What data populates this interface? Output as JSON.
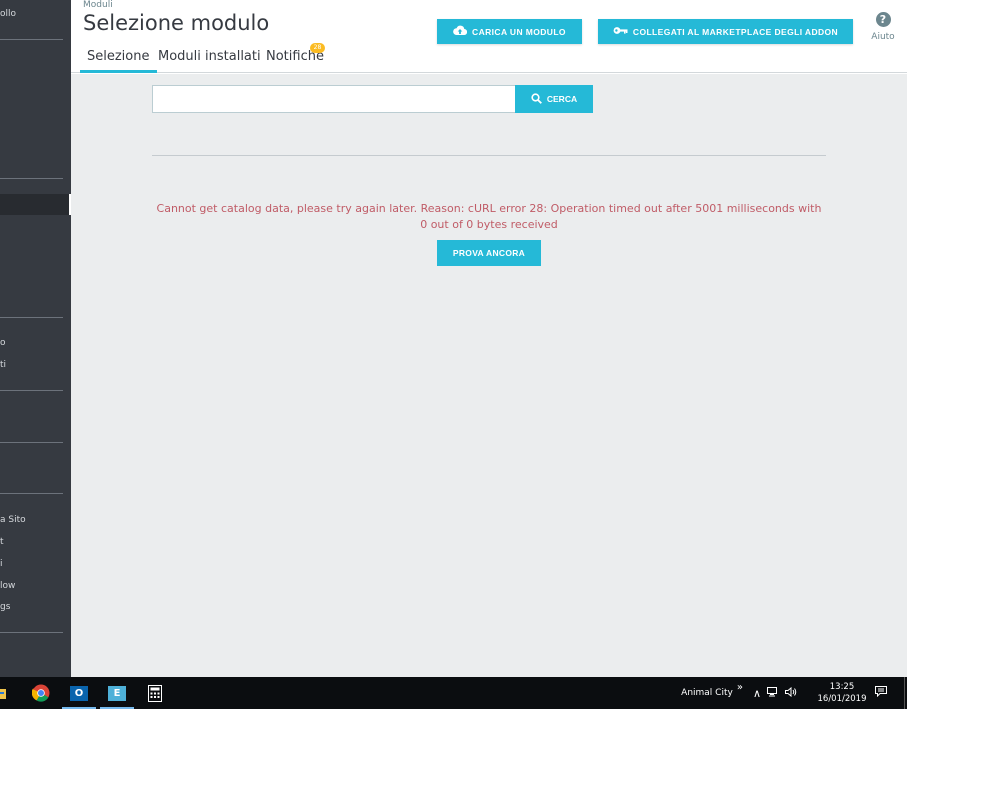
{
  "sidebar": {
    "items": [
      {
        "label": "ollo"
      },
      {
        "label": "o"
      },
      {
        "label": "ti"
      },
      {
        "label": "a Sito"
      },
      {
        "label": "t"
      },
      {
        "label": "i"
      },
      {
        "label": "low"
      },
      {
        "label": "gs"
      }
    ]
  },
  "header": {
    "breadcrumb": "Moduli",
    "title": "Selezione modulo",
    "tabs": [
      {
        "label": "Selezione",
        "active": true
      },
      {
        "label": "Moduli installati",
        "active": false
      },
      {
        "label": "Notifiche",
        "active": false
      }
    ],
    "notifications_count": "28",
    "upload_button": "CARICA UN MODULO",
    "marketplace_button": "COLLEGATI AL MARKETPLACE DEGLI ADDON",
    "help_label": "Aiuto"
  },
  "main": {
    "search_placeholder": "",
    "search_value": "",
    "search_button": "CERCA",
    "error_message": "Cannot get catalog data, please try again later. Reason: cURL error 28: Operation timed out after 5001 milliseconds with 0 out of 0 bytes received",
    "retry_button": "PROVA ANCORA"
  },
  "taskbar": {
    "apps": [
      "file-explorer-icon",
      "chrome-icon",
      "outlook-icon",
      "excel-icon",
      "calculator-icon"
    ],
    "outlook_glyph": "O",
    "excel_glyph": "E",
    "toolbar_name": "Animal City",
    "chevron": "»",
    "time": "13:25",
    "date": "16/01/2019"
  },
  "colors": {
    "accent": "#25b9d7",
    "sidebar": "#363a41",
    "content_bg": "#ebedee",
    "error_text": "#c05c67",
    "badge": "#fbbb22"
  }
}
